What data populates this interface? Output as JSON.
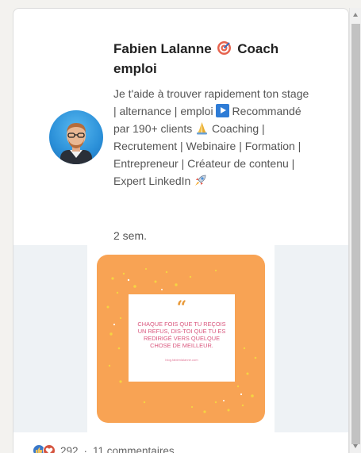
{
  "post": {
    "author_name": "Fabien Lalanne",
    "author_role": "Coach emploi",
    "headline_1": "Je t'aide à trouver rapidement ton stage | alternance | emploi",
    "headline_2": "Recommandé par 190+ clients",
    "headline_3": "Coaching | Recrutement | Webinaire | Formation | Entrepreneur | Créateur de contenu | Expert LinkedIn",
    "time": "2 sem.",
    "icons": [
      "target-icon",
      "play-icon",
      "pray-icon",
      "rocket-icon"
    ],
    "accent_color": "#f8a354",
    "text_accent_color": "#d9567d"
  },
  "image": {
    "quote_mark": "“",
    "quote_text": "CHAQUE FOIS QUE TU REÇOIS UN REFUS, DIS-TOI QUE TU ES REDIRIGÉ VERS QUELQUE CHOSE DE MEILLEUR.",
    "site": "blog.fabienlalanne.com"
  },
  "social": {
    "reactions_count": "292",
    "separator": "·",
    "comments": "11 commentaires",
    "reaction_icons": [
      "like-icon",
      "love-icon"
    ]
  }
}
